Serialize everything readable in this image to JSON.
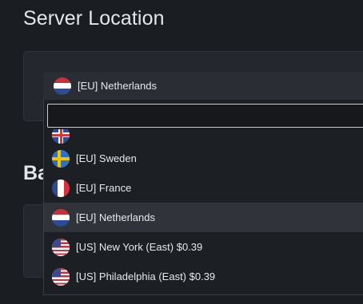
{
  "page": {
    "section_title": "Server Location",
    "section_title_2_partial": "Ba"
  },
  "select": {
    "selected_value": "[EU] Netherlands",
    "selected_flag": "netherlands-flag-icon",
    "search_value": "",
    "search_placeholder": ""
  },
  "options": [
    {
      "label": "",
      "flag": "united-kingdom-flag-icon",
      "partial": true
    },
    {
      "label": "[EU] Sweden",
      "flag": "sweden-flag-icon"
    },
    {
      "label": "[EU] France",
      "flag": "france-flag-icon"
    },
    {
      "label": "[EU] Netherlands",
      "flag": "netherlands-flag-icon",
      "selected": true
    },
    {
      "label": "[US] New York (East) $0.39",
      "flag": "usa-flag-icon"
    },
    {
      "label": "[US] Philadelphia (East) $0.39",
      "flag": "usa-flag-icon"
    }
  ],
  "colors": {
    "background": "#1a1d21",
    "card": "#24282e",
    "selected_row": "#30343a",
    "text": "#e6e8ea"
  }
}
